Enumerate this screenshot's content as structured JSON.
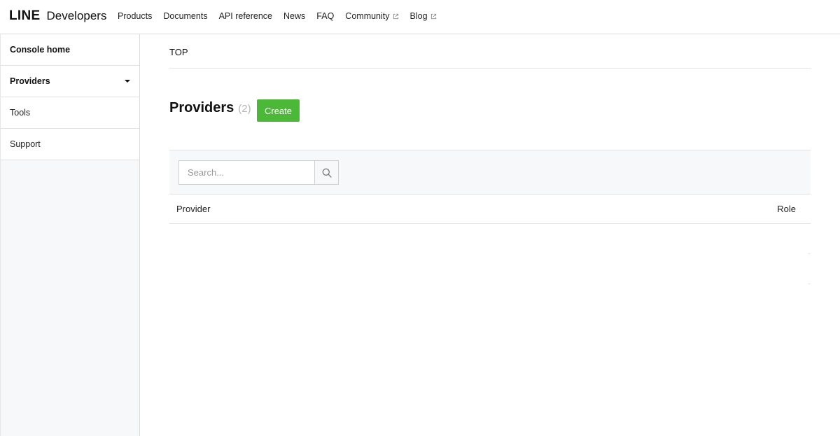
{
  "header": {
    "logo_line": "LINE",
    "logo_developers": "Developers",
    "nav": [
      {
        "label": "Products",
        "external": false
      },
      {
        "label": "Documents",
        "external": false
      },
      {
        "label": "API reference",
        "external": false
      },
      {
        "label": "News",
        "external": false
      },
      {
        "label": "FAQ",
        "external": false
      },
      {
        "label": "Community",
        "external": true
      },
      {
        "label": "Blog",
        "external": true
      }
    ]
  },
  "sidebar": {
    "items": [
      {
        "label": "Console home"
      },
      {
        "label": "Providers"
      },
      {
        "label": "Tools"
      },
      {
        "label": "Support"
      }
    ]
  },
  "breadcrumb": {
    "current": "TOP"
  },
  "main": {
    "title": "Providers",
    "count": "(2)",
    "create_label": "Create"
  },
  "search": {
    "placeholder": "Search...",
    "value": ""
  },
  "table": {
    "columns": [
      "Provider",
      "Role"
    ]
  },
  "colors": {
    "accent": "#4cb838",
    "border": "#dcdcdc",
    "panel": "#f7f8fa"
  },
  "icons": {
    "search": "search-icon",
    "external": "external-link-icon",
    "caret": "caret-down-icon"
  }
}
